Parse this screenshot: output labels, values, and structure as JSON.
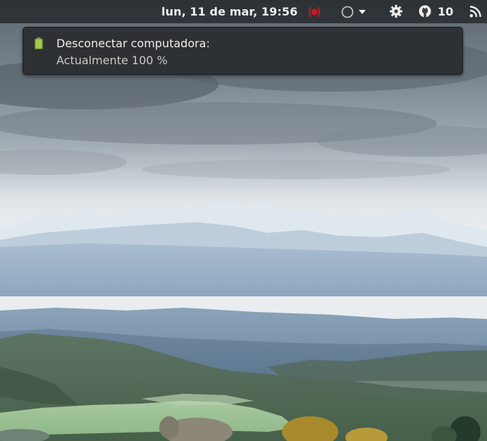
{
  "topbar": {
    "clock": "lun, 11 de mar, 19:56",
    "github_count": "10",
    "icons": [
      "screen-record-icon",
      "status-circle-icon",
      "chevron-down-icon",
      "gear-icon",
      "github-icon",
      "rss-icon"
    ]
  },
  "notification": {
    "icon": "battery-full-icon",
    "title": "Desconectar computadora:",
    "body": "Actualmente 100 %"
  },
  "colors": {
    "topbar_bg": "#1c1e20",
    "notification_bg": "#2e3134",
    "record_red": "#c01c28",
    "battery_green": "#8bb33a"
  }
}
